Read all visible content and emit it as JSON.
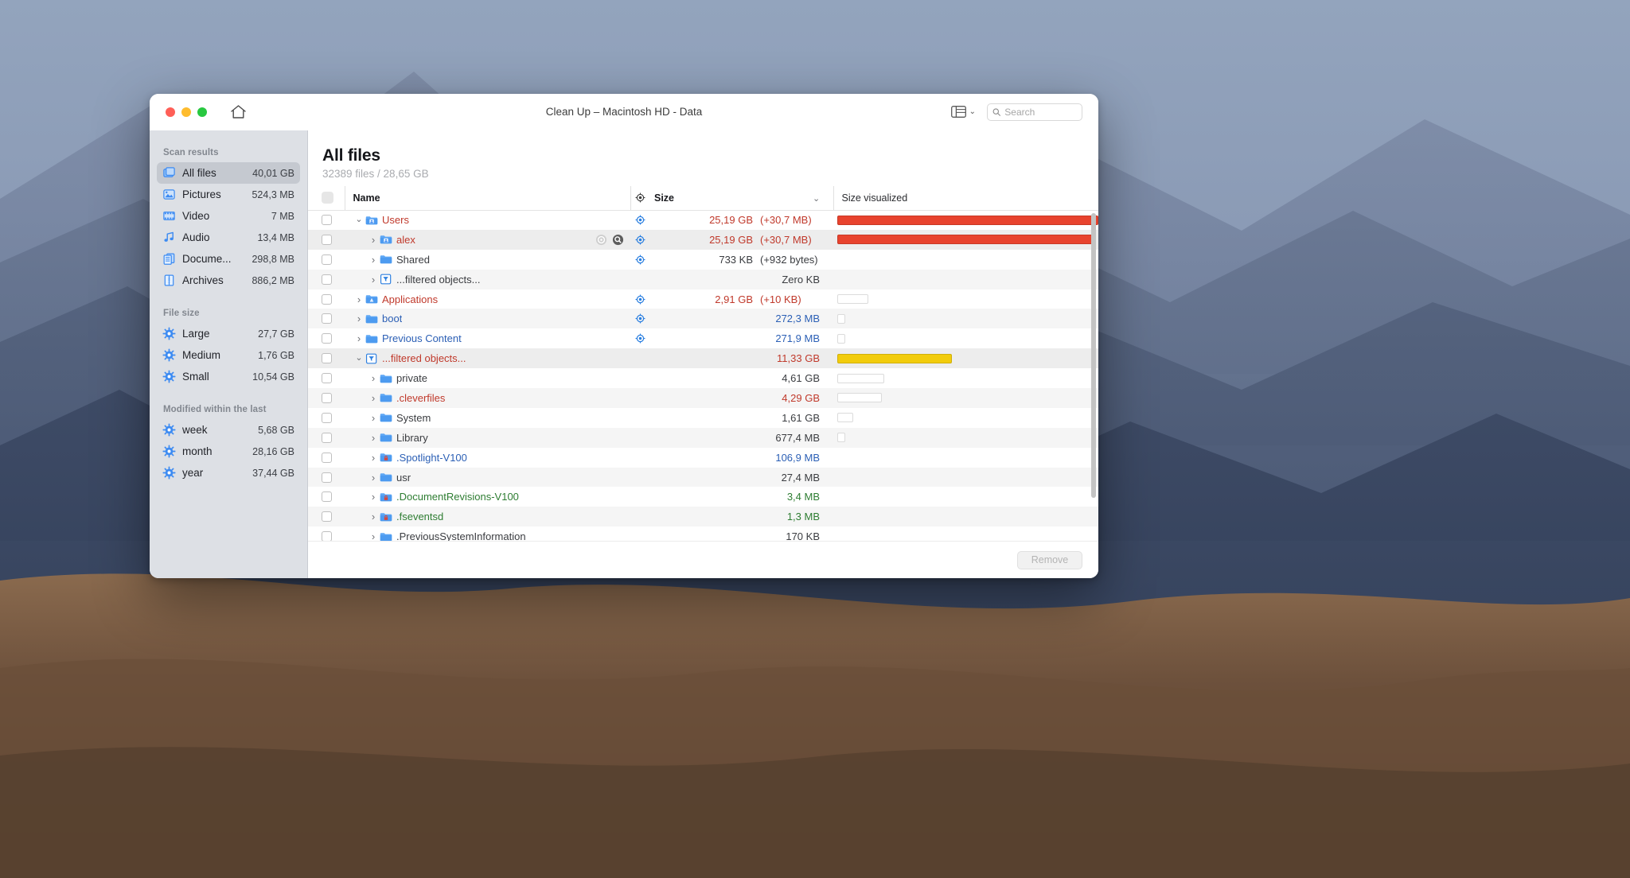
{
  "window": {
    "title": "Clean Up – Macintosh HD - Data",
    "traffic_lights": [
      "close",
      "minimize",
      "zoom"
    ],
    "home_icon": "home-icon",
    "view_icon": "column-view-icon",
    "view_chevron": "⌄"
  },
  "search": {
    "placeholder": "Search",
    "value": "",
    "icon": "search-icon"
  },
  "sidebar": {
    "sections": [
      {
        "title": "Scan results",
        "items": [
          {
            "label": "All files",
            "value": "40,01 GB",
            "icon": "all-files-icon",
            "active": true
          },
          {
            "label": "Pictures",
            "value": "524,3 MB",
            "icon": "pictures-icon",
            "active": false
          },
          {
            "label": "Video",
            "value": "7 MB",
            "icon": "video-icon",
            "active": false
          },
          {
            "label": "Audio",
            "value": "13,4 MB",
            "icon": "audio-icon",
            "active": false
          },
          {
            "label": "Docume...",
            "value": "298,8 MB",
            "icon": "documents-icon",
            "active": false
          },
          {
            "label": "Archives",
            "value": "886,2 MB",
            "icon": "archives-icon",
            "active": false
          }
        ]
      },
      {
        "title": "File size",
        "items": [
          {
            "label": "Large",
            "value": "27,7 GB",
            "icon": "gear-icon",
            "active": false
          },
          {
            "label": "Medium",
            "value": "1,76 GB",
            "icon": "gear-icon",
            "active": false
          },
          {
            "label": "Small",
            "value": "10,54 GB",
            "icon": "gear-icon",
            "active": false
          }
        ]
      },
      {
        "title": "Modified within the last",
        "items": [
          {
            "label": "week",
            "value": "5,68 GB",
            "icon": "gear-icon",
            "active": false
          },
          {
            "label": "month",
            "value": "28,16 GB",
            "icon": "gear-icon",
            "active": false
          },
          {
            "label": "year",
            "value": "37,44 GB",
            "icon": "gear-icon",
            "active": false
          }
        ]
      }
    ]
  },
  "main": {
    "title": "All files",
    "subtitle": "32389 files / 28,65 GB",
    "columns": {
      "check": "",
      "name": "Name",
      "target_icon": "target-icon",
      "size": "Size",
      "sort_chevron": "⌄",
      "size_visualized": "Size visualized"
    },
    "rows": [
      {
        "name": "Users",
        "indent": 0,
        "twisty": "down",
        "icon": "folder-user-icon",
        "name_color": "red",
        "target": true,
        "size": "25,19 GB",
        "delta": "(+30,7 MB)",
        "size_color": "red",
        "bar_pct": 100,
        "bar_color": "#e8432e",
        "striped": false,
        "highlight": false,
        "actions": []
      },
      {
        "name": "alex",
        "indent": 1,
        "twisty": "right",
        "icon": "folder-home-icon",
        "name_color": "red",
        "target": true,
        "size": "25,19 GB",
        "delta": "(+30,7 MB)",
        "size_color": "red",
        "bar_pct": 99,
        "bar_color": "#e8432e",
        "striped": true,
        "highlight": true,
        "actions": [
          "scan-icon",
          "magnifier-icon"
        ]
      },
      {
        "name": "Shared",
        "indent": 1,
        "twisty": "right",
        "icon": "folder-icon",
        "name_color": "gray",
        "target": true,
        "size": "733 KB",
        "delta": "(+932 bytes)",
        "size_color": "gray",
        "bar_pct": 0,
        "bar_color": "",
        "striped": false,
        "highlight": false,
        "actions": []
      },
      {
        "name": "...filtered objects...",
        "indent": 1,
        "twisty": "right",
        "icon": "filter-icon",
        "name_color": "gray",
        "target": false,
        "size": "Zero KB",
        "delta": "",
        "size_color": "gray",
        "bar_pct": 0,
        "bar_color": "",
        "striped": true,
        "highlight": false,
        "actions": []
      },
      {
        "name": "Applications",
        "indent": 0,
        "twisty": "right",
        "icon": "folder-apps-icon",
        "name_color": "red",
        "target": true,
        "size": "2,91 GB",
        "delta": "(+10 KB)",
        "size_color": "red",
        "bar_pct": 12,
        "bar_color": "#ffffff",
        "striped": false,
        "highlight": false,
        "actions": []
      },
      {
        "name": "boot",
        "indent": 0,
        "twisty": "right",
        "icon": "folder-icon",
        "name_color": "blue",
        "target": true,
        "size": "272,3 MB",
        "delta": "",
        "size_color": "blue",
        "bar_pct": 3,
        "bar_color": "#ffffff",
        "striped": true,
        "highlight": false,
        "actions": []
      },
      {
        "name": "Previous Content",
        "indent": 0,
        "twisty": "right",
        "icon": "folder-icon",
        "name_color": "blue",
        "target": true,
        "size": "271,9 MB",
        "delta": "",
        "size_color": "blue",
        "bar_pct": 3,
        "bar_color": "#ffffff",
        "striped": false,
        "highlight": false,
        "actions": []
      },
      {
        "name": "...filtered objects...",
        "indent": 0,
        "twisty": "down",
        "icon": "filter-icon",
        "name_color": "red",
        "target": false,
        "size": "11,33 GB",
        "delta": "",
        "size_color": "red",
        "bar_pct": 44,
        "bar_color": "#f2cc0c",
        "striped": true,
        "highlight": true,
        "actions": []
      },
      {
        "name": "private",
        "indent": 1,
        "twisty": "right",
        "icon": "folder-icon",
        "name_color": "gray",
        "target": false,
        "size": "4,61 GB",
        "delta": "",
        "size_color": "gray",
        "bar_pct": 18,
        "bar_color": "#ffffff",
        "striped": false,
        "highlight": false,
        "actions": []
      },
      {
        "name": ".cleverfiles",
        "indent": 1,
        "twisty": "right",
        "icon": "folder-icon",
        "name_color": "red",
        "target": false,
        "size": "4,29 GB",
        "delta": "",
        "size_color": "red",
        "bar_pct": 17,
        "bar_color": "#ffffff",
        "striped": true,
        "highlight": false,
        "actions": []
      },
      {
        "name": "System",
        "indent": 1,
        "twisty": "right",
        "icon": "folder-icon",
        "name_color": "gray",
        "target": false,
        "size": "1,61 GB",
        "delta": "",
        "size_color": "gray",
        "bar_pct": 6,
        "bar_color": "#ffffff",
        "striped": false,
        "highlight": false,
        "actions": []
      },
      {
        "name": "Library",
        "indent": 1,
        "twisty": "right",
        "icon": "folder-icon",
        "name_color": "gray",
        "target": false,
        "size": "677,4 MB",
        "delta": "",
        "size_color": "gray",
        "bar_pct": 3,
        "bar_color": "#ffffff",
        "striped": true,
        "highlight": false,
        "actions": []
      },
      {
        "name": ".Spotlight-V100",
        "indent": 1,
        "twisty": "right",
        "icon": "folder-lock-icon",
        "name_color": "blue",
        "target": false,
        "size": "106,9 MB",
        "delta": "",
        "size_color": "blue",
        "bar_pct": 0,
        "bar_color": "",
        "striped": false,
        "highlight": false,
        "actions": []
      },
      {
        "name": "usr",
        "indent": 1,
        "twisty": "right",
        "icon": "folder-icon",
        "name_color": "gray",
        "target": false,
        "size": "27,4 MB",
        "delta": "",
        "size_color": "gray",
        "bar_pct": 0,
        "bar_color": "",
        "striped": true,
        "highlight": false,
        "actions": []
      },
      {
        "name": ".DocumentRevisions-V100",
        "indent": 1,
        "twisty": "right",
        "icon": "folder-lock-icon",
        "name_color": "green",
        "target": false,
        "size": "3,4 MB",
        "delta": "",
        "size_color": "green",
        "bar_pct": 0,
        "bar_color": "",
        "striped": false,
        "highlight": false,
        "actions": []
      },
      {
        "name": ".fseventsd",
        "indent": 1,
        "twisty": "right",
        "icon": "folder-lock-icon",
        "name_color": "green",
        "target": false,
        "size": "1,3 MB",
        "delta": "",
        "size_color": "green",
        "bar_pct": 0,
        "bar_color": "",
        "striped": true,
        "highlight": false,
        "actions": []
      },
      {
        "name": ".PreviousSystemInformation",
        "indent": 1,
        "twisty": "right",
        "icon": "folder-icon",
        "name_color": "gray",
        "target": false,
        "size": "170 KB",
        "delta": "",
        "size_color": "gray",
        "bar_pct": 0,
        "bar_color": "",
        "striped": false,
        "highlight": false,
        "actions": []
      }
    ]
  },
  "footer": {
    "remove_label": "Remove"
  },
  "colors": {
    "accent_red": "#c0392b",
    "accent_blue": "#2b5fb5",
    "bar_red": "#e8432e",
    "bar_yellow": "#f2cc0c",
    "sidebar_bg": "#dde0e5",
    "selection": "#c5c9d0"
  }
}
